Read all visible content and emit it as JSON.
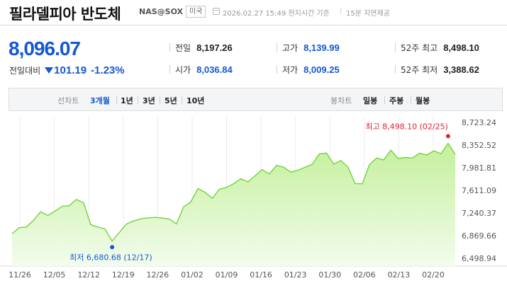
{
  "header": {
    "title": "필라델피아 반도체",
    "ticker": "NAS@SOX",
    "market_badge": "미국",
    "datetime": "2026.02.27 15:49 현지시간 기준",
    "separator": "|",
    "delay_note": "15분 지연제공"
  },
  "quote": {
    "price": "8,096.07",
    "change_label": "전일대비",
    "change_value": "101.19",
    "change_percent": "-1.23%",
    "direction": "down"
  },
  "stats": {
    "prev_close": {
      "label": "전일",
      "value": "8,197.26"
    },
    "open": {
      "label": "시가",
      "value": "8,036.84"
    },
    "high": {
      "label": "고가",
      "value": "8,139.99"
    },
    "low": {
      "label": "저가",
      "value": "8,009.25"
    },
    "high_52w": {
      "label": "52주 최고",
      "value": "8,498.10"
    },
    "low_52w": {
      "label": "52주 최저",
      "value": "3,388.62"
    }
  },
  "tabs": {
    "line_label": "선차트",
    "line_ranges": [
      "3개월",
      "1년",
      "3년",
      "5년",
      "10년"
    ],
    "active_range": "3개월",
    "candle_label": "봉차트",
    "candle_ranges": [
      "일봉",
      "주봉",
      "월봉"
    ]
  },
  "colors": {
    "accent_blue": "#1458d6",
    "line_green": "#72d43c",
    "area_green_top": "#c4f09c",
    "area_green_bottom": "#f3fced",
    "high_marker": "#e5202e",
    "low_marker": "#1458d6"
  },
  "chart_data": {
    "type": "area",
    "x_tick_labels": [
      "11/26",
      "12/05",
      "12/12",
      "12/19",
      "12/26",
      "01/02",
      "01/09",
      "01/16",
      "01/23",
      "01/30",
      "02/06",
      "02/13",
      "02/20"
    ],
    "y_tick_labels": [
      "8,723.24",
      "8,352.52",
      "7,981.81",
      "7,611.09",
      "7,240.37",
      "6,869.66",
      "6,498.94"
    ],
    "ylim": [
      6498.94,
      8723.24
    ],
    "grid": "vertical",
    "values": [
      6900,
      7000,
      7010,
      7120,
      7260,
      7200,
      7270,
      7350,
      7360,
      7460,
      7410,
      7050,
      7010,
      6980,
      6780,
      6920,
      7060,
      7110,
      7145,
      7160,
      7168,
      7158,
      7140,
      7060,
      7340,
      7420,
      7640,
      7580,
      7480,
      7630,
      7660,
      7720,
      7800,
      7750,
      7850,
      7950,
      7880,
      8020,
      7990,
      7910,
      7940,
      7990,
      8040,
      8210,
      8220,
      8040,
      8100,
      7990,
      7720,
      7720,
      8030,
      8140,
      8110,
      8270,
      8130,
      8150,
      8140,
      8220,
      8190,
      8260,
      8210,
      8380,
      8200
    ],
    "high_annotation": "최고 8,498.10 (02/25)",
    "low_annotation": "최저 6,680.68 (12/17)",
    "high_point": {
      "index": 61,
      "value": 8498.1
    },
    "low_point": {
      "index": 14,
      "value": 6680.68
    }
  }
}
